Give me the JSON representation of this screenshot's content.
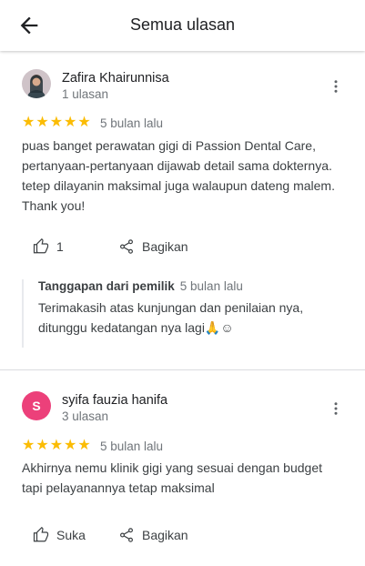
{
  "header": {
    "title": "Semua ulasan"
  },
  "reviews": [
    {
      "author": "Zafira Khairunnisa",
      "review_count": "1 ulasan",
      "rating": 5,
      "date": "5 bulan lalu",
      "lines": [
        "puas banget perawatan gigi di Passion Dental Care,",
        "pertanyaan-pertanyaan dijawab detail sama dokternya.",
        "tetep dilayanin maksimal juga walaupun dateng malem.",
        "Thank you!"
      ],
      "like_label": "1",
      "share_label": "Bagikan",
      "reply": {
        "owner_label": "Tanggapan dari pemilik",
        "date": "5 bulan lalu",
        "lines": [
          "Terimakasih atas kunjungan dan penilaian nya,",
          "ditunggu kedatangan nya lagi🙏☺"
        ]
      }
    },
    {
      "author": "syifa fauzia hanifa",
      "avatar_letter": "S",
      "review_count": "3 ulasan",
      "rating": 5,
      "date": "5 bulan lalu",
      "lines": [
        "Akhirnya nemu klinik gigi yang sesuai dengan budget",
        "tapi pelayanannya tetap maksimal"
      ],
      "like_label": "Suka",
      "share_label": "Bagikan"
    }
  ],
  "colors": {
    "star": "#fbbc04",
    "avatar_pink": "#ec407a"
  }
}
